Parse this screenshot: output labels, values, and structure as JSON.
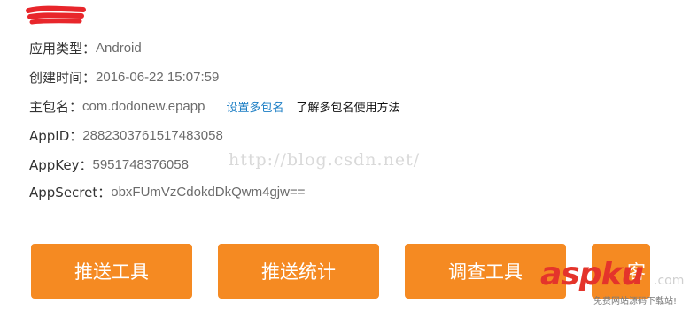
{
  "app_info": {
    "platform_label": "应用类型：",
    "platform_value": "Android",
    "created_label": "创建时间：",
    "created_value": "2016-06-22 15:07:59",
    "package_label": "主包名：",
    "package_value": "com.dodonew.epapp",
    "set_multi_package_link": "设置多包名",
    "learn_multi_package_link": "了解多包名使用方法",
    "appid_label": "AppID：",
    "appid_value": "2882303761517483058",
    "appkey_label": "AppKey：",
    "appkey_value": "5951748376058",
    "appsecret_label": "AppSecret：",
    "appsecret_value": "obxFUmVzCdokdDkQwm4gjw=="
  },
  "watermark": {
    "url_text": "http://blog.csdn.net/"
  },
  "actions": {
    "push_tool": "推送工具",
    "push_stats": "推送统计",
    "survey_tool": "调查工具",
    "partial_fourth": "客"
  },
  "aspku_watermark": {
    "brand": "aspku",
    "tld": ".com",
    "slogan": "免费网站源码下载站!"
  },
  "colors": {
    "button_orange": "#f58a22",
    "link_blue": "#1a7dc4",
    "redaction_red": "#e8262b",
    "aspku_red": "#e4342b"
  }
}
